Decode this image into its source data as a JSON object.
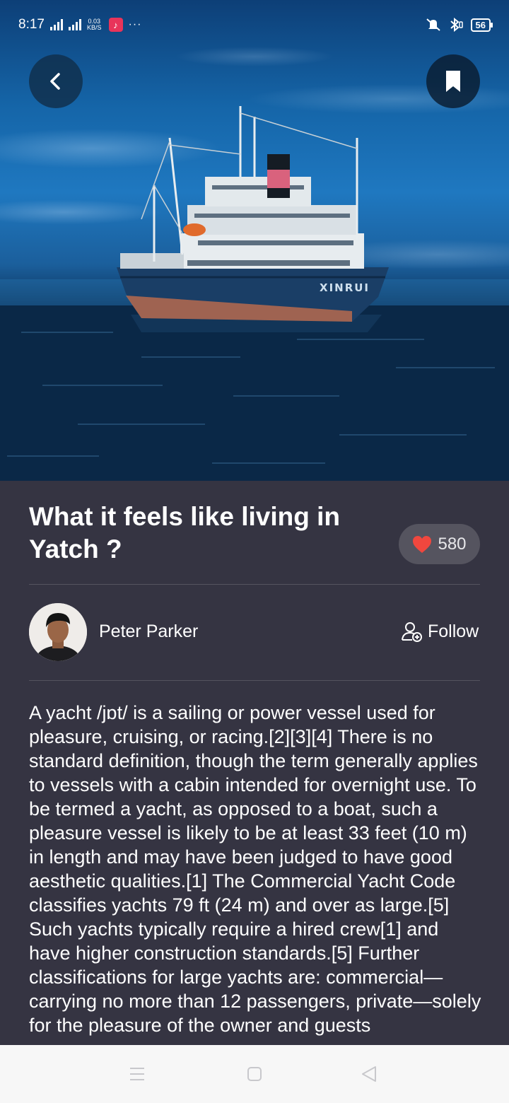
{
  "status_bar": {
    "time": "8:17",
    "network_speed_value": "0.03",
    "network_speed_unit": "KB/S",
    "battery": "56",
    "icons": [
      "signal-icon",
      "signal-hplus-icon",
      "music-app-icon",
      "more-dots-icon",
      "mute-icon",
      "bluetooth-icon",
      "battery-icon"
    ]
  },
  "hero": {
    "ship_name": "XINRUI"
  },
  "article": {
    "title": "What it feels like living in Yatch ?",
    "likes": "580",
    "author": "Peter Parker",
    "follow_label": "Follow",
    "body": "A yacht /jɒt/ is a sailing or power vessel used for pleasure, cruising, or racing.[2][3][4] There is no standard definition, though the term generally applies to vessels with a cabin intended for overnight use. To be termed a yacht, as opposed to a boat, such a pleasure vessel is likely to be at least 33 feet (10 m) in length and may have been judged to have good aesthetic qualities.[1] The Commercial Yacht Code classifies yachts 79 ft (24 m) and over as large.[5] Such yachts typically require a hired crew[1] and have higher construction standards.[5] Further classifications for large yachts are: commercial—carrying no more than 12 passengers, private—solely for the pleasure of the owner and guests"
  },
  "colors": {
    "content_background": "#353442",
    "pill_background": "#55545f",
    "heart": "#f0473e",
    "navbar_background": "#f7f7f7"
  }
}
